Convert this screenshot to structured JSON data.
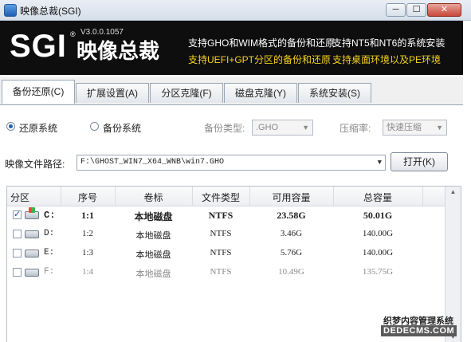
{
  "window": {
    "title": "映像总裁(SGI)",
    "min_glyph": "─",
    "max_glyph": "☐",
    "close_glyph": "✕"
  },
  "banner": {
    "logo": "SGI",
    "reg": "®",
    "version": "V3.0.0.1057",
    "name_cn": "映像总裁",
    "features": [
      "支持GHO和WIM格式的备份和还原",
      "支持NT5和NT6的系统安装",
      "支持UEFI+GPT分区的备份和还原",
      "支持桌面环境以及PE环境"
    ]
  },
  "tabs": [
    "备份还原(C)",
    "扩展设置(A)",
    "分区克隆(F)",
    "磁盘克隆(Y)",
    "系统安装(S)"
  ],
  "options": {
    "restore_label": "还原系统",
    "backup_label": "备份系统",
    "backup_type_label": "备份类型:",
    "backup_type_value": ".GHO",
    "compress_label": "压缩率:",
    "compress_value": "快速压缩"
  },
  "image_path": {
    "label": "映像文件路径:",
    "value": "F:\\GHOST_WIN7_X64_WNB\\win7.GHO",
    "open_button": "打开(K)"
  },
  "table": {
    "headers": [
      "分区",
      "序号",
      "卷标",
      "文件类型",
      "可用容量",
      "总容量"
    ],
    "rows": [
      {
        "checked": true,
        "letter": "C:",
        "index": "1:1",
        "label": "本地磁盘",
        "fs": "NTFS",
        "free": "23.58G",
        "total": "50.01G"
      },
      {
        "checked": false,
        "letter": "D:",
        "index": "1:2",
        "label": "本地磁盘",
        "fs": "NTFS",
        "free": "3.46G",
        "total": "140.00G"
      },
      {
        "checked": false,
        "letter": "E:",
        "index": "1:3",
        "label": "本地磁盘",
        "fs": "NTFS",
        "free": "5.76G",
        "total": "140.00G"
      },
      {
        "checked": false,
        "letter": "F:",
        "index": "1:4",
        "label": "本地磁盘",
        "fs": "NTFS",
        "free": "10.49G",
        "total": "135.75G"
      }
    ]
  },
  "watermark": {
    "line1": "织梦内容管理系统",
    "line2": "DEDECMS.COM"
  },
  "colors": {
    "banner_bg": "#0e0e0e",
    "feature_yellow": "#f2d21f"
  }
}
